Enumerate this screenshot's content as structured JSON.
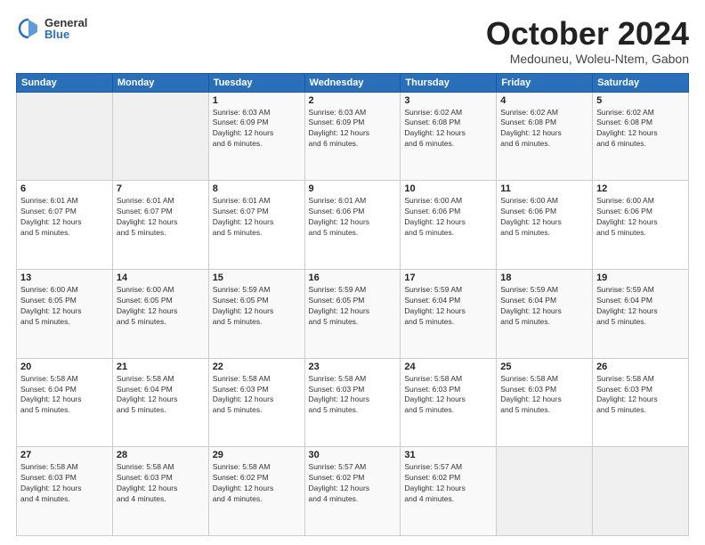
{
  "logo": {
    "general": "General",
    "blue": "Blue"
  },
  "title": "October 2024",
  "location": "Medouneu, Woleu-Ntem, Gabon",
  "days_of_week": [
    "Sunday",
    "Monday",
    "Tuesday",
    "Wednesday",
    "Thursday",
    "Friday",
    "Saturday"
  ],
  "weeks": [
    [
      {
        "day": "",
        "info": ""
      },
      {
        "day": "",
        "info": ""
      },
      {
        "day": "1",
        "info": "Sunrise: 6:03 AM\nSunset: 6:09 PM\nDaylight: 12 hours\nand 6 minutes."
      },
      {
        "day": "2",
        "info": "Sunrise: 6:03 AM\nSunset: 6:09 PM\nDaylight: 12 hours\nand 6 minutes."
      },
      {
        "day": "3",
        "info": "Sunrise: 6:02 AM\nSunset: 6:08 PM\nDaylight: 12 hours\nand 6 minutes."
      },
      {
        "day": "4",
        "info": "Sunrise: 6:02 AM\nSunset: 6:08 PM\nDaylight: 12 hours\nand 6 minutes."
      },
      {
        "day": "5",
        "info": "Sunrise: 6:02 AM\nSunset: 6:08 PM\nDaylight: 12 hours\nand 6 minutes."
      }
    ],
    [
      {
        "day": "6",
        "info": "Sunrise: 6:01 AM\nSunset: 6:07 PM\nDaylight: 12 hours\nand 5 minutes."
      },
      {
        "day": "7",
        "info": "Sunrise: 6:01 AM\nSunset: 6:07 PM\nDaylight: 12 hours\nand 5 minutes."
      },
      {
        "day": "8",
        "info": "Sunrise: 6:01 AM\nSunset: 6:07 PM\nDaylight: 12 hours\nand 5 minutes."
      },
      {
        "day": "9",
        "info": "Sunrise: 6:01 AM\nSunset: 6:06 PM\nDaylight: 12 hours\nand 5 minutes."
      },
      {
        "day": "10",
        "info": "Sunrise: 6:00 AM\nSunset: 6:06 PM\nDaylight: 12 hours\nand 5 minutes."
      },
      {
        "day": "11",
        "info": "Sunrise: 6:00 AM\nSunset: 6:06 PM\nDaylight: 12 hours\nand 5 minutes."
      },
      {
        "day": "12",
        "info": "Sunrise: 6:00 AM\nSunset: 6:06 PM\nDaylight: 12 hours\nand 5 minutes."
      }
    ],
    [
      {
        "day": "13",
        "info": "Sunrise: 6:00 AM\nSunset: 6:05 PM\nDaylight: 12 hours\nand 5 minutes."
      },
      {
        "day": "14",
        "info": "Sunrise: 6:00 AM\nSunset: 6:05 PM\nDaylight: 12 hours\nand 5 minutes."
      },
      {
        "day": "15",
        "info": "Sunrise: 5:59 AM\nSunset: 6:05 PM\nDaylight: 12 hours\nand 5 minutes."
      },
      {
        "day": "16",
        "info": "Sunrise: 5:59 AM\nSunset: 6:05 PM\nDaylight: 12 hours\nand 5 minutes."
      },
      {
        "day": "17",
        "info": "Sunrise: 5:59 AM\nSunset: 6:04 PM\nDaylight: 12 hours\nand 5 minutes."
      },
      {
        "day": "18",
        "info": "Sunrise: 5:59 AM\nSunset: 6:04 PM\nDaylight: 12 hours\nand 5 minutes."
      },
      {
        "day": "19",
        "info": "Sunrise: 5:59 AM\nSunset: 6:04 PM\nDaylight: 12 hours\nand 5 minutes."
      }
    ],
    [
      {
        "day": "20",
        "info": "Sunrise: 5:58 AM\nSunset: 6:04 PM\nDaylight: 12 hours\nand 5 minutes."
      },
      {
        "day": "21",
        "info": "Sunrise: 5:58 AM\nSunset: 6:04 PM\nDaylight: 12 hours\nand 5 minutes."
      },
      {
        "day": "22",
        "info": "Sunrise: 5:58 AM\nSunset: 6:03 PM\nDaylight: 12 hours\nand 5 minutes."
      },
      {
        "day": "23",
        "info": "Sunrise: 5:58 AM\nSunset: 6:03 PM\nDaylight: 12 hours\nand 5 minutes."
      },
      {
        "day": "24",
        "info": "Sunrise: 5:58 AM\nSunset: 6:03 PM\nDaylight: 12 hours\nand 5 minutes."
      },
      {
        "day": "25",
        "info": "Sunrise: 5:58 AM\nSunset: 6:03 PM\nDaylight: 12 hours\nand 5 minutes."
      },
      {
        "day": "26",
        "info": "Sunrise: 5:58 AM\nSunset: 6:03 PM\nDaylight: 12 hours\nand 5 minutes."
      }
    ],
    [
      {
        "day": "27",
        "info": "Sunrise: 5:58 AM\nSunset: 6:03 PM\nDaylight: 12 hours\nand 4 minutes."
      },
      {
        "day": "28",
        "info": "Sunrise: 5:58 AM\nSunset: 6:03 PM\nDaylight: 12 hours\nand 4 minutes."
      },
      {
        "day": "29",
        "info": "Sunrise: 5:58 AM\nSunset: 6:02 PM\nDaylight: 12 hours\nand 4 minutes."
      },
      {
        "day": "30",
        "info": "Sunrise: 5:57 AM\nSunset: 6:02 PM\nDaylight: 12 hours\nand 4 minutes."
      },
      {
        "day": "31",
        "info": "Sunrise: 5:57 AM\nSunset: 6:02 PM\nDaylight: 12 hours\nand 4 minutes."
      },
      {
        "day": "",
        "info": ""
      },
      {
        "day": "",
        "info": ""
      }
    ]
  ]
}
